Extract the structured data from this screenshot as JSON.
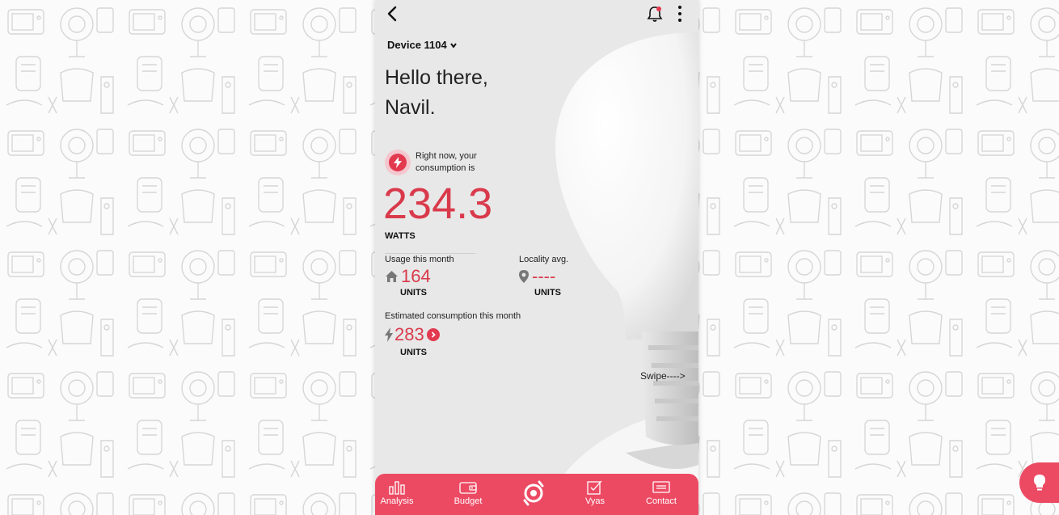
{
  "header": {
    "device_label": "Device 1104"
  },
  "greeting": {
    "line1": "Hello there,",
    "line2": "Navil."
  },
  "current": {
    "caption": "Right now, your consumption is",
    "value": "234.3",
    "unit": "WATTS"
  },
  "usage_month": {
    "label": "Usage this month",
    "value": "164",
    "unit": "UNITS"
  },
  "locality": {
    "label": "Locality avg.",
    "value": "----",
    "unit": "UNITS"
  },
  "estimate": {
    "label": "Estimated consumption this month",
    "value": "283",
    "unit": "UNITS"
  },
  "swipe_hint": "Swipe---->",
  "nav": {
    "analysis": "Analysis",
    "budget": "Budget",
    "vyas": "Vyas",
    "contact": "Contact"
  },
  "colors": {
    "accent": "#ec4a63",
    "value_red": "#d93a4b",
    "panel_bg": "#e8e8e8"
  },
  "icons": [
    "back-arrow-icon",
    "bell-icon",
    "more-vertical-icon",
    "chevron-down-icon",
    "bolt-icon",
    "home-icon",
    "location-pin-icon",
    "chevron-right-icon",
    "bar-chart-icon",
    "wallet-icon",
    "brand-logo-icon",
    "checklist-icon",
    "message-icon",
    "lightbulb-icon"
  ]
}
